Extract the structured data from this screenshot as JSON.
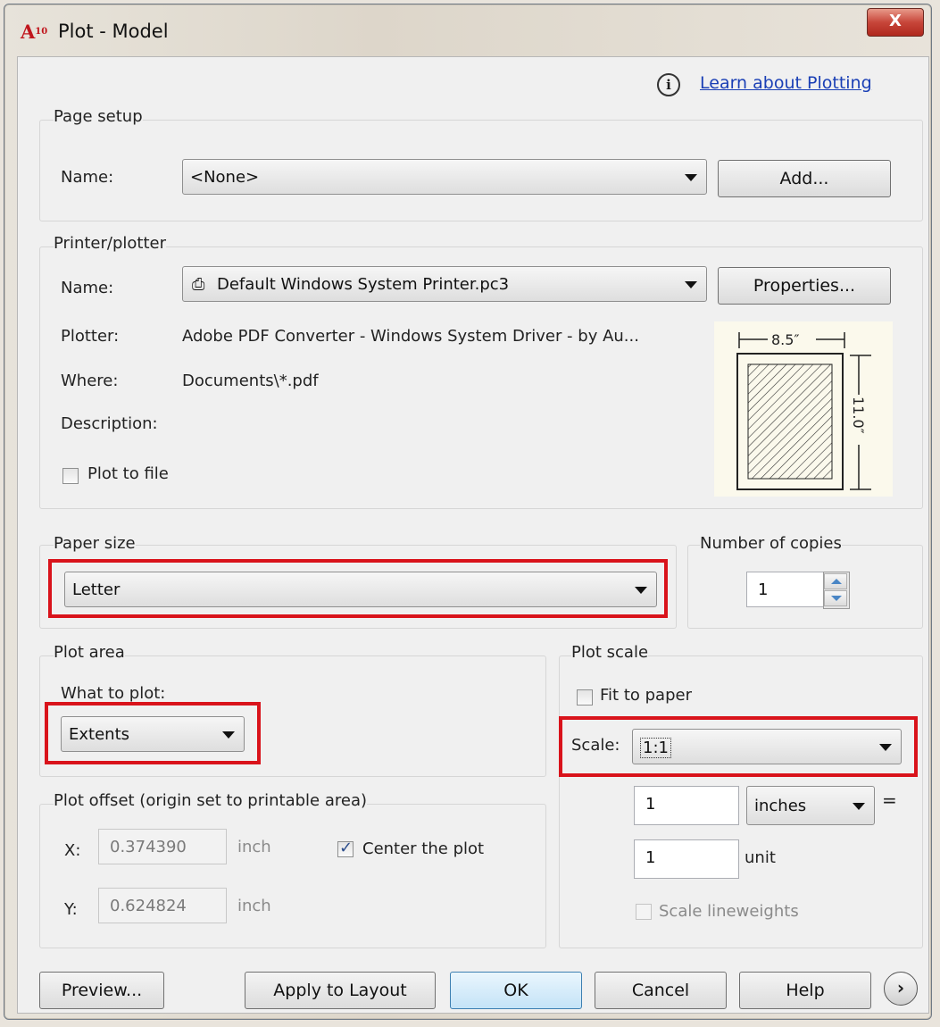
{
  "window": {
    "title": "Plot - Model",
    "app_icon_label": "A",
    "app_icon_ver": "10",
    "close_glyph": "X"
  },
  "help": {
    "link_text": "Learn about Plotting",
    "info_glyph": "i"
  },
  "page_setup": {
    "group_label": "Page setup",
    "name_label": "Name:",
    "name_value": "<None>",
    "add_button": "Add..."
  },
  "printer": {
    "group_label": "Printer/plotter",
    "name_label": "Name:",
    "name_value": "Default Windows System Printer.pc3",
    "properties_button": "Properties...",
    "plotter_label": "Plotter:",
    "plotter_value": "Adobe PDF Converter - Windows System Driver - by Au...",
    "where_label": "Where:",
    "where_value": "Documents\\*.pdf",
    "description_label": "Description:",
    "plot_to_file_label": "Plot to file",
    "plot_to_file_checked": false,
    "paper_width_label": "8.5″",
    "paper_height_label": "11.0″"
  },
  "paper_size": {
    "group_label": "Paper size",
    "value": "Letter"
  },
  "copies": {
    "group_label": "Number of copies",
    "value": "1"
  },
  "plot_area": {
    "group_label": "Plot area",
    "what_to_plot_label": "What to plot:",
    "what_to_plot_value": "Extents"
  },
  "plot_offset": {
    "group_label": "Plot offset (origin set to printable area)",
    "x_label": "X:",
    "x_value": "0.374390",
    "x_unit": "inch",
    "y_label": "Y:",
    "y_value": "0.624824",
    "y_unit": "inch",
    "center_label": "Center the plot",
    "center_checked": true
  },
  "plot_scale": {
    "group_label": "Plot scale",
    "fit_label": "Fit to paper",
    "fit_checked": false,
    "scale_label": "Scale:",
    "scale_value": "1:1",
    "value1": "1",
    "unit1": "inches",
    "equals": "=",
    "value2": "1",
    "unit2": "unit",
    "lineweights_label": "Scale lineweights",
    "lineweights_checked": false
  },
  "buttons": {
    "preview": "Preview...",
    "apply": "Apply to Layout",
    "ok": "OK",
    "cancel": "Cancel",
    "help": "Help",
    "more": "›"
  },
  "colors": {
    "highlight": "#d9131b",
    "link": "#1a3fb5",
    "close": "#c7463a"
  }
}
